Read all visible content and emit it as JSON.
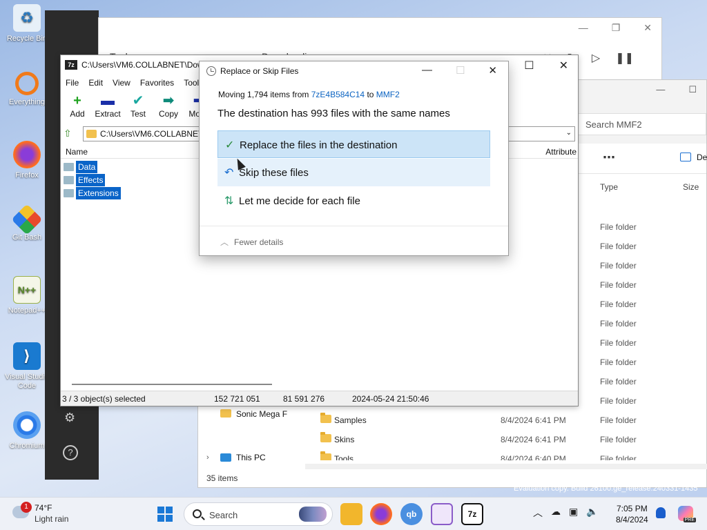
{
  "desktop": {
    "icons": [
      {
        "label": "Recycle Bin",
        "icon": "recycle-bin-icon"
      },
      {
        "label": "Everything",
        "icon": "everything-icon"
      },
      {
        "label": "Firefox",
        "icon": "firefox-icon"
      },
      {
        "label": "Git Bash",
        "icon": "git-bash-icon"
      },
      {
        "label": "Notepad++",
        "icon": "notepad-plus-plus-icon"
      },
      {
        "label": "Visual Studio Code",
        "icon": "vscode-icon"
      },
      {
        "label": "Chromium",
        "icon": "chromium-icon"
      }
    ]
  },
  "browser": {
    "tab_title": "Tools",
    "page_title": "Downloading"
  },
  "explorer": {
    "search_placeholder": "Search MMF2",
    "cmd_details": "De",
    "headers": {
      "type": "Type",
      "size": "Size"
    },
    "folder_types": [
      "File folder",
      "File folder",
      "File folder",
      "File folder",
      "File folder",
      "File folder",
      "File folder",
      "File folder",
      "File folder",
      "File folder"
    ],
    "nav": {
      "sonic": "Sonic Mega F",
      "this_pc": "This PC"
    },
    "rows": [
      {
        "name": "Samples",
        "date": "8/4/2024 6:41 PM",
        "type": "File folder"
      },
      {
        "name": "Skins",
        "date": "8/4/2024 6:41 PM",
        "type": "File folder"
      },
      {
        "name": "Tools",
        "date": "8/4/2024 6:40 PM",
        "type": "File folder"
      }
    ],
    "status": "35 items"
  },
  "sevenzip": {
    "title": "C:\\Users\\VM6.COLLABNET\\Down",
    "icon_text": "7z",
    "menu": [
      "File",
      "Edit",
      "View",
      "Favorites",
      "Tools"
    ],
    "toolbar": [
      {
        "label": "Add",
        "glyph": "+",
        "color": "#1fa21f"
      },
      {
        "label": "Extract",
        "glyph": "▬",
        "color": "#1a2fa8"
      },
      {
        "label": "Test",
        "glyph": "✔",
        "color": "#1ba8a0"
      },
      {
        "label": "Copy",
        "glyph": "➡",
        "color": "#0e8a7a"
      },
      {
        "label": "Move",
        "glyph": "➡",
        "color": "#1a2fa8"
      }
    ],
    "address": "C:\\Users\\VM6.COLLABNET\\",
    "col_name": "Name",
    "col_attr": "Attribute",
    "items": [
      "Data",
      "Effects",
      "Extensions"
    ],
    "status": {
      "selected": "3 / 3 object(s) selected",
      "size": "152 721 051",
      "packed": "81 591 276",
      "modified": "2024-05-24 21:50:46"
    }
  },
  "dialog": {
    "title": "Replace or Skip Files",
    "moving_prefix": "Moving 1,794 items from ",
    "source": "7zE4B584C14",
    "to_word": " to ",
    "destination": "MMF2",
    "headline": "The destination has 993 files with the same names",
    "options": {
      "replace": "Replace the files in the destination",
      "skip": "Skip these files",
      "decide": "Let me decide for each file"
    },
    "fewer_details": "Fewer details"
  },
  "watermark": "Evaluation copy. Build 26100.ge_release.240331-1435",
  "taskbar": {
    "weather_temp": "74°F",
    "weather_cond": "Light rain",
    "weather_badge": "1",
    "search_label": "Search",
    "time": "7:05 PM",
    "date": "8/4/2024",
    "copilot_badge": "PRE",
    "apps": [
      {
        "name": "file-explorer-taskbar-icon",
        "color": "#f2b62c",
        "text": ""
      },
      {
        "name": "firefox-taskbar-icon",
        "color": "#e8622a",
        "text": ""
      },
      {
        "name": "qbittorrent-taskbar-icon",
        "color": "#4a8fe0",
        "text": "qb"
      },
      {
        "name": "notes-taskbar-icon",
        "color": "#8a5cc8",
        "text": ""
      },
      {
        "name": "7zip-taskbar-icon",
        "color": "#111111",
        "text": "7z"
      }
    ]
  }
}
